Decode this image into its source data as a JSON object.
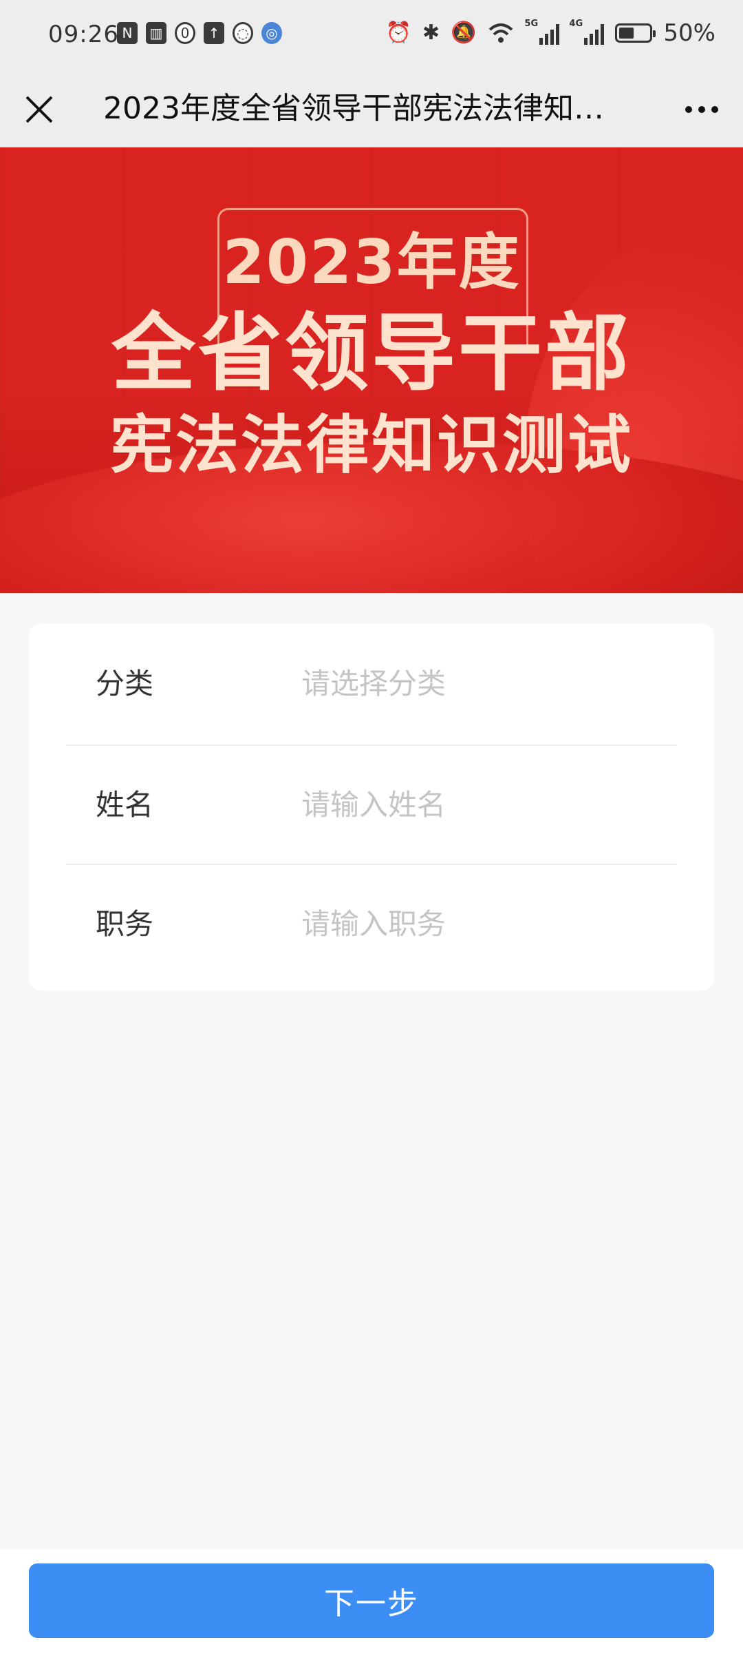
{
  "status_bar": {
    "time": "09:26",
    "left_icons": [
      "nfc-icon",
      "gift-icon",
      "shield-app-icon",
      "upload-icon",
      "chat-bubble-icon",
      "browser-icon"
    ],
    "network_5g_label": "5G",
    "network_4g_label": "4G",
    "battery_percent": "50%",
    "battery_level": 0.5
  },
  "nav": {
    "title": "2023年度全省领导干部宪法法律知…",
    "close_icon": "close-icon",
    "more_icon": "more-dots-icon"
  },
  "banner": {
    "year": "2023年度",
    "line1": "全省领导干部",
    "line2": "宪法法律知识测试",
    "colors": {
      "background": "#d9231f",
      "text": "#fde2cd"
    }
  },
  "form": {
    "rows": [
      {
        "label": "分类",
        "placeholder": "请选择分类",
        "value": ""
      },
      {
        "label": "姓名",
        "placeholder": "请输入姓名",
        "value": ""
      },
      {
        "label": "职务",
        "placeholder": "请输入职务",
        "value": ""
      }
    ]
  },
  "actions": {
    "next_label": "下一步",
    "accent_color": "#3d8ef4"
  }
}
